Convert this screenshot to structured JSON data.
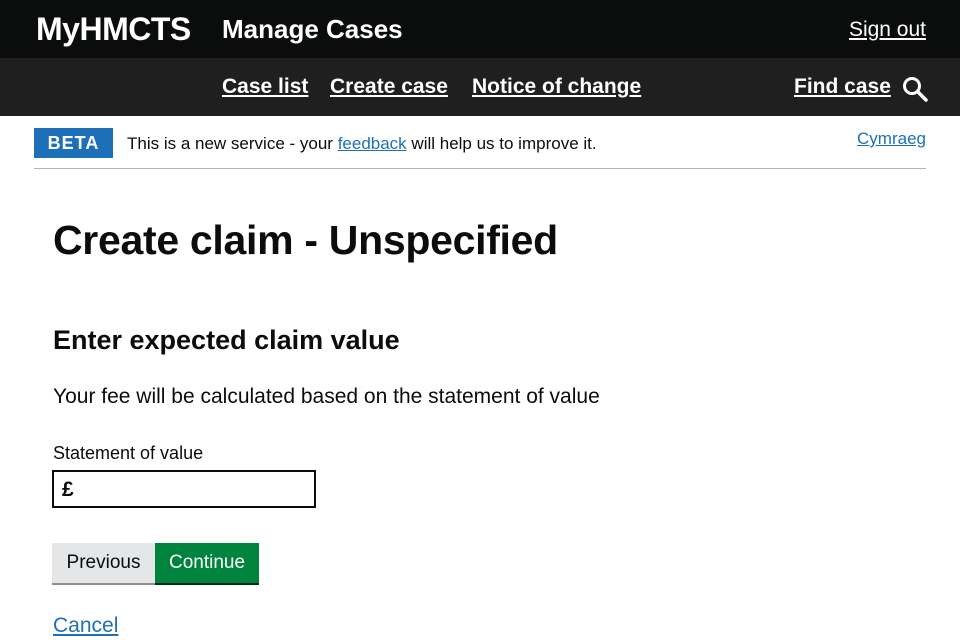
{
  "header": {
    "brand": "MyHMCTS",
    "service_name": "Manage Cases",
    "sign_out": "Sign out"
  },
  "nav": {
    "case_list": "Case list",
    "create_case": "Create case",
    "notice_of_change": "Notice of change",
    "find_case": "Find case",
    "search_icon": "search-icon"
  },
  "beta": {
    "tag": "BETA",
    "text_before": "This is a new service - your ",
    "feedback_link": "feedback",
    "text_after": " will help us to improve it.",
    "language_link": "Cymraeg"
  },
  "main": {
    "title": "Create claim - Unspecified",
    "heading": "Enter expected claim value",
    "hint": "Your fee will be calculated based on the statement of value",
    "field_label": "Statement of value",
    "currency_symbol": "£",
    "field_value": "",
    "previous_label": "Previous",
    "continue_label": "Continue",
    "cancel_label": "Cancel"
  },
  "colors": {
    "header_bg": "#0b0c0c",
    "nav_bg": "#1f1f1f",
    "beta_tag": "#1d70b8",
    "link": "#1d70b8",
    "continue_button": "#00843d",
    "previous_button": "#e4e6e8"
  }
}
